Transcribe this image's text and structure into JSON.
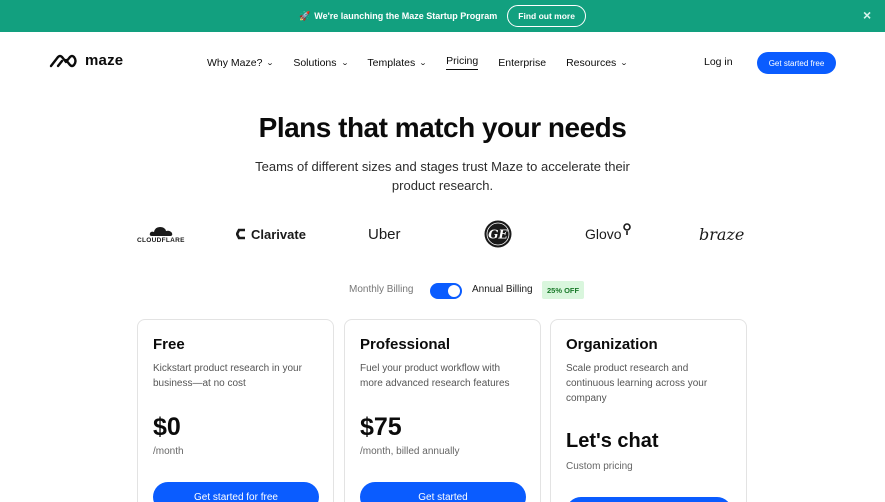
{
  "announcement": {
    "text": "We're launching the Maze Startup Program",
    "button": "Find out more"
  },
  "nav": {
    "brand": "maze",
    "menu": [
      {
        "label": "Why Maze?",
        "dropdown": true
      },
      {
        "label": "Solutions",
        "dropdown": true
      },
      {
        "label": "Templates",
        "dropdown": true
      },
      {
        "label": "Pricing",
        "dropdown": false,
        "active": true
      },
      {
        "label": "Enterprise",
        "dropdown": false
      },
      {
        "label": "Resources",
        "dropdown": true
      }
    ],
    "login": "Log in",
    "cta": "Get started free"
  },
  "hero": {
    "title": "Plans that match your needs",
    "subtitle": "Teams of different sizes and stages trust Maze to accelerate their product research."
  },
  "logos": {
    "cloudflare": "CLOUDFLARE",
    "clarivate": "Clarivate",
    "uber": "Uber",
    "ge": "GE",
    "glovo": "Glovo",
    "braze": "braze"
  },
  "billing": {
    "monthly": "Monthly Billing",
    "annual": "Annual Billing",
    "discount": "25% OFF",
    "annual_selected": true
  },
  "plans": [
    {
      "name": "Free",
      "description": "Kickstart product research in your business—at no cost",
      "price": "$0",
      "price_note": "/month",
      "button": "Get started for free"
    },
    {
      "name": "Professional",
      "description": "Fuel your product workflow with more advanced research features",
      "price": "$75",
      "price_note": "/month, billed annually",
      "button": "Get started"
    },
    {
      "name": "Organization",
      "description": "Scale product research and continuous learning across your company",
      "price": "Let's chat",
      "price_note": "Custom pricing",
      "button": ""
    }
  ],
  "colors": {
    "announcement_bg": "#12a07f",
    "primary_blue": "#0a5cff",
    "discount_bg": "#d9f6dd"
  }
}
